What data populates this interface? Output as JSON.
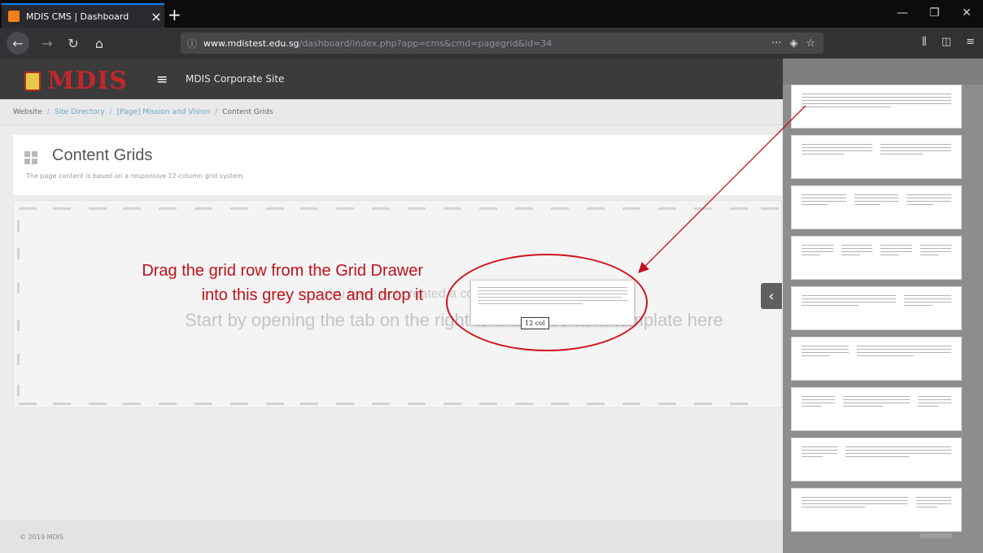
{
  "browser": {
    "tab_title": "MDIS CMS | Dashboard",
    "url_domain": "www.mdistest.edu.sg",
    "url_path": "/dashboard/index.php?app=cms&cmd=pagegrid&id=34"
  },
  "cms": {
    "logo_text": "MDIS",
    "site_name": "MDIS Corporate Site"
  },
  "breadcrumb": {
    "items": [
      "Website",
      "Site Directory",
      "[Page] Mission and Vision"
    ],
    "current": "Content Grids"
  },
  "page": {
    "title": "Content Grids",
    "subtitle": "The page content is based on a responsive 12-column grid system"
  },
  "dropzone": {
    "empty_line1": "You have not created a content grid for this Page",
    "empty_line2": "Start by opening the tab on the right to drag a content template here"
  },
  "annotation": {
    "text": "Drag the grid row from the Grid Drawer into this grey space and drop it"
  },
  "drag_item": {
    "label": "12 col"
  },
  "footer": {
    "copyright": "© 2019 MDIS"
  },
  "icons": {
    "tab_close": "close-icon",
    "new_tab": "plus-icon",
    "back": "arrow-left-icon",
    "reload": "reload-icon",
    "home": "home-icon",
    "menu": "hamburger-icon",
    "drawer_toggle": "chevron-left-icon"
  },
  "colors": {
    "brand_red": "#c1272d",
    "annotation_red": "#c0111a",
    "breadcrumb_link": "#6aa7c4"
  }
}
